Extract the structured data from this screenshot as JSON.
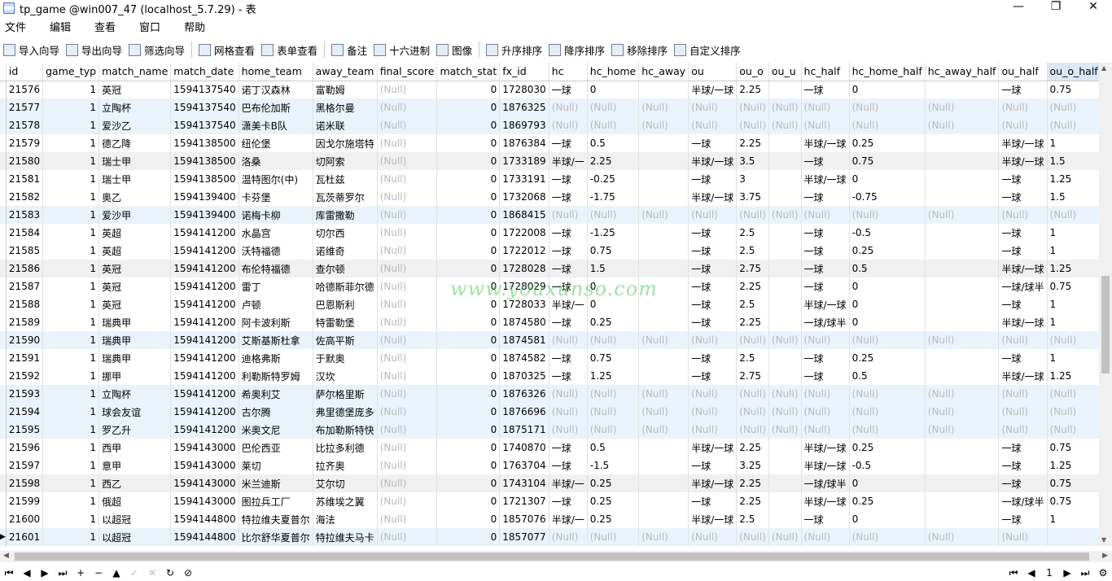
{
  "window": {
    "title": "tp_game @win007_47 (localhost_5.7.29) - 表",
    "min": "—",
    "max": "❐",
    "close": "✕"
  },
  "menu": [
    "文件",
    "编辑",
    "查看",
    "窗口",
    "帮助"
  ],
  "toolbar": [
    {
      "label": "导入向导",
      "icon": "import-wizard-icon"
    },
    {
      "label": "导出向导",
      "icon": "export-wizard-icon"
    },
    {
      "label": "筛选向导",
      "icon": "filter-icon"
    },
    {
      "label": "网格查看",
      "icon": "grid-view-icon"
    },
    {
      "label": "表单查看",
      "icon": "form-view-icon"
    },
    {
      "label": "备注",
      "icon": "memo-icon"
    },
    {
      "label": "十六进制",
      "icon": "hex-icon"
    },
    {
      "label": "图像",
      "icon": "image-icon"
    },
    {
      "label": "升序排序",
      "icon": "sort-asc-icon"
    },
    {
      "label": "降序排序",
      "icon": "sort-desc-icon"
    },
    {
      "label": "移除排序",
      "icon": "remove-sort-icon"
    },
    {
      "label": "自定义排序",
      "icon": "custom-sort-icon"
    }
  ],
  "columns": [
    "id",
    "game_typ",
    "match_name",
    "match_date",
    "home_team",
    "away_team",
    "final_score",
    "match_stat",
    "fx_id",
    "hc",
    "hc_home",
    "hc_away",
    "ou",
    "ou_o",
    "ou_u",
    "hc_half",
    "hc_home_half",
    "hc_away_half",
    "ou_half",
    "ou_o_half",
    "ou_"
  ],
  "rows": [
    [
      "21576",
      "1",
      "英冠",
      "1594137540",
      "诺丁汉森林",
      "富勒姆",
      "(Null)",
      "0",
      "1728030",
      "一球",
      "0",
      "",
      "半球/一球",
      "2.25",
      "",
      "一球",
      "0",
      "",
      "一球",
      "0.75",
      ""
    ],
    [
      "21577",
      "1",
      "立陶杯",
      "1594137540",
      "巴布伦加斯",
      "黑格尔曼",
      "(Null)",
      "0",
      "1876325",
      "(Null)",
      "(Null)",
      "(Null)",
      "(Null)",
      "(Null)",
      "(Null)",
      "(Null)",
      "(Null)",
      "(Null)",
      "(Null)",
      "(Null)",
      "(Nu"
    ],
    [
      "21578",
      "1",
      "爱沙乙",
      "1594137540",
      "潇美卡B队",
      "诺米联",
      "(Null)",
      "0",
      "1869793",
      "(Null)",
      "(Null)",
      "(Null)",
      "(Null)",
      "(Null)",
      "(Null)",
      "(Null)",
      "(Null)",
      "(Null)",
      "(Null)",
      "(Null)",
      "(Nu"
    ],
    [
      "21579",
      "1",
      "德乙降",
      "1594138500",
      "纽伦堡",
      "因戈尔施塔特",
      "(Null)",
      "0",
      "1876384",
      "一球",
      "0.5",
      "",
      "一球",
      "2.25",
      "",
      "半球/一球",
      "0.25",
      "",
      "半球/一球",
      "1",
      ""
    ],
    [
      "21580",
      "1",
      "瑞士甲",
      "1594138500",
      "洛桑",
      "切阿索",
      "(Null)",
      "0",
      "1733189",
      "半球/一",
      "2.25",
      "",
      "半球/一球",
      "3.5",
      "",
      "一球",
      "0.75",
      "",
      "半球/一球",
      "1.5",
      ""
    ],
    [
      "21581",
      "1",
      "瑞士甲",
      "1594138500",
      "温特图尔(中)",
      "瓦杜兹",
      "(Null)",
      "0",
      "1733191",
      "一球",
      "-0.25",
      "",
      "一球",
      "3",
      "",
      "半球/一球",
      "0",
      "",
      "一球",
      "1.25",
      ""
    ],
    [
      "21582",
      "1",
      "奥乙",
      "1594139400",
      "卡芬堡",
      "瓦茨蒂罗尔",
      "(Null)",
      "0",
      "1732068",
      "一球",
      "-1.75",
      "",
      "半球/一球",
      "3.75",
      "",
      "一球",
      "-0.75",
      "",
      "一球",
      "1.5",
      ""
    ],
    [
      "21583",
      "1",
      "爱沙甲",
      "1594139400",
      "诺梅卡柳",
      "库雷撒勒",
      "(Null)",
      "0",
      "1868415",
      "(Null)",
      "(Null)",
      "(Null)",
      "(Null)",
      "(Null)",
      "(Null)",
      "(Null)",
      "(Null)",
      "(Null)",
      "(Null)",
      "(Null)",
      "(Nu"
    ],
    [
      "21584",
      "1",
      "英超",
      "1594141200",
      "水晶宫",
      "切尔西",
      "(Null)",
      "0",
      "1722008",
      "一球",
      "-1.25",
      "",
      "一球",
      "2.5",
      "",
      "一球",
      "-0.5",
      "",
      "一球",
      "1",
      ""
    ],
    [
      "21585",
      "1",
      "英超",
      "1594141200",
      "沃特福德",
      "诺维奇",
      "(Null)",
      "0",
      "1722012",
      "一球",
      "0.75",
      "",
      "一球",
      "2.5",
      "",
      "一球",
      "0.25",
      "",
      "一球",
      "1",
      ""
    ],
    [
      "21586",
      "1",
      "英冠",
      "1594141200",
      "布伦特福德",
      "查尔顿",
      "(Null)",
      "0",
      "1728028",
      "一球",
      "1.5",
      "",
      "一球",
      "2.75",
      "",
      "一球",
      "0.5",
      "",
      "半球/一球",
      "1.25",
      ""
    ],
    [
      "21587",
      "1",
      "英冠",
      "1594141200",
      "雷丁",
      "哈德斯菲尔德",
      "(Null)",
      "0",
      "1728029",
      "一球",
      "0",
      "",
      "一球",
      "2.25",
      "",
      "一球",
      "0",
      "",
      "一球/球半",
      "0.75",
      ""
    ],
    [
      "21588",
      "1",
      "英冠",
      "1594141200",
      "卢顿",
      "巴恩斯利",
      "(Null)",
      "0",
      "1728033",
      "半球/一",
      "0",
      "",
      "一球",
      "2.5",
      "",
      "半球/一球",
      "0",
      "",
      "一球",
      "1",
      ""
    ],
    [
      "21589",
      "1",
      "瑞典甲",
      "1594141200",
      "阿卡波利斯",
      "特雷勒堡",
      "(Null)",
      "0",
      "1874580",
      "一球",
      "0.25",
      "",
      "一球",
      "2.25",
      "",
      "一球/球半",
      "0",
      "",
      "半球/一球",
      "1",
      ""
    ],
    [
      "21590",
      "1",
      "瑞典甲",
      "1594141200",
      "艾斯基斯杜拿",
      "佐高平斯",
      "(Null)",
      "0",
      "1874581",
      "(Null)",
      "(Null)",
      "(Null)",
      "(Null)",
      "(Null)",
      "(Null)",
      "(Null)",
      "(Null)",
      "(Null)",
      "(Null)",
      "(Null)",
      "(Nu"
    ],
    [
      "21591",
      "1",
      "瑞典甲",
      "1594141200",
      "迪格弗斯",
      "于默奥",
      "(Null)",
      "0",
      "1874582",
      "一球",
      "0.75",
      "",
      "一球",
      "2.5",
      "",
      "一球",
      "0.25",
      "",
      "一球",
      "1",
      ""
    ],
    [
      "21592",
      "1",
      "挪甲",
      "1594141200",
      "利勒斯特罗姆",
      "汉坎",
      "(Null)",
      "0",
      "1870325",
      "一球",
      "1.25",
      "",
      "一球",
      "2.75",
      "",
      "一球",
      "0.5",
      "",
      "半球/一球",
      "1.25",
      ""
    ],
    [
      "21593",
      "1",
      "立陶杯",
      "1594141200",
      "希奥利艾",
      "萨尔格里斯",
      "(Null)",
      "0",
      "1876326",
      "(Null)",
      "(Null)",
      "(Null)",
      "(Null)",
      "(Null)",
      "(Null)",
      "(Null)",
      "(Null)",
      "(Null)",
      "(Null)",
      "(Null)",
      "(Nu"
    ],
    [
      "21594",
      "1",
      "球会友谊",
      "1594141200",
      "古尔腾",
      "弗里德堡庞多",
      "(Null)",
      "0",
      "1876696",
      "(Null)",
      "(Null)",
      "(Null)",
      "(Null)",
      "(Null)",
      "(Null)",
      "(Null)",
      "(Null)",
      "(Null)",
      "(Null)",
      "(Null)",
      "(Nu"
    ],
    [
      "21595",
      "1",
      "罗乙升",
      "1594141200",
      "米奥文尼",
      "布加勒斯特快",
      "(Null)",
      "0",
      "1875171",
      "(Null)",
      "(Null)",
      "(Null)",
      "(Null)",
      "(Null)",
      "(Null)",
      "(Null)",
      "(Null)",
      "(Null)",
      "(Null)",
      "(Null)",
      "(Nu"
    ],
    [
      "21596",
      "1",
      "西甲",
      "1594143000",
      "巴伦西亚",
      "比拉多利德",
      "(Null)",
      "0",
      "1740870",
      "一球",
      "0.5",
      "",
      "半球/一球",
      "2.25",
      "",
      "半球/一球",
      "0.25",
      "",
      "一球",
      "0.75",
      ""
    ],
    [
      "21597",
      "1",
      "意甲",
      "1594143000",
      "莱切",
      "拉齐奥",
      "(Null)",
      "0",
      "1763704",
      "一球",
      "-1.5",
      "",
      "一球",
      "3.25",
      "",
      "半球/一球",
      "-0.5",
      "",
      "一球",
      "1.25",
      ""
    ],
    [
      "21598",
      "1",
      "西乙",
      "1594143000",
      "米兰迪斯",
      "艾尔切",
      "(Null)",
      "0",
      "1743104",
      "半球/一",
      "0.25",
      "",
      "半球/一球",
      "2.25",
      "",
      "一球/球半",
      "0",
      "",
      "一球",
      "0.75",
      ""
    ],
    [
      "21599",
      "1",
      "俄超",
      "1594143000",
      "图拉兵工厂",
      "苏维埃之翼",
      "(Null)",
      "0",
      "1721307",
      "一球",
      "0.25",
      "",
      "一球",
      "2.25",
      "",
      "半球/一球",
      "0.25",
      "",
      "一球/球半",
      "0.75",
      ""
    ],
    [
      "21600",
      "1",
      "以超冠",
      "1594144800",
      "特拉维夫夏普尔",
      "海法",
      "(Null)",
      "0",
      "1857076",
      "半球/一",
      "0.25",
      "",
      "半球/一球",
      "2.5",
      "",
      "一球",
      "0",
      "",
      "一球",
      "1",
      ""
    ],
    [
      "21601",
      "1",
      "以超冠",
      "1594144800",
      "比尔舒华夏普尔",
      "特拉维夫马卡",
      "(Null)",
      "0",
      "1857077",
      "(Null)",
      "(Null)",
      "(Null)",
      "(Null)",
      "(Null)",
      "(Null)",
      "(Null)",
      "(Null)",
      "(Null)",
      "(Null)",
      "",
      "(Nu"
    ]
  ],
  "watermark": "www.youxunso.com",
  "nav": {
    "page": "1"
  }
}
